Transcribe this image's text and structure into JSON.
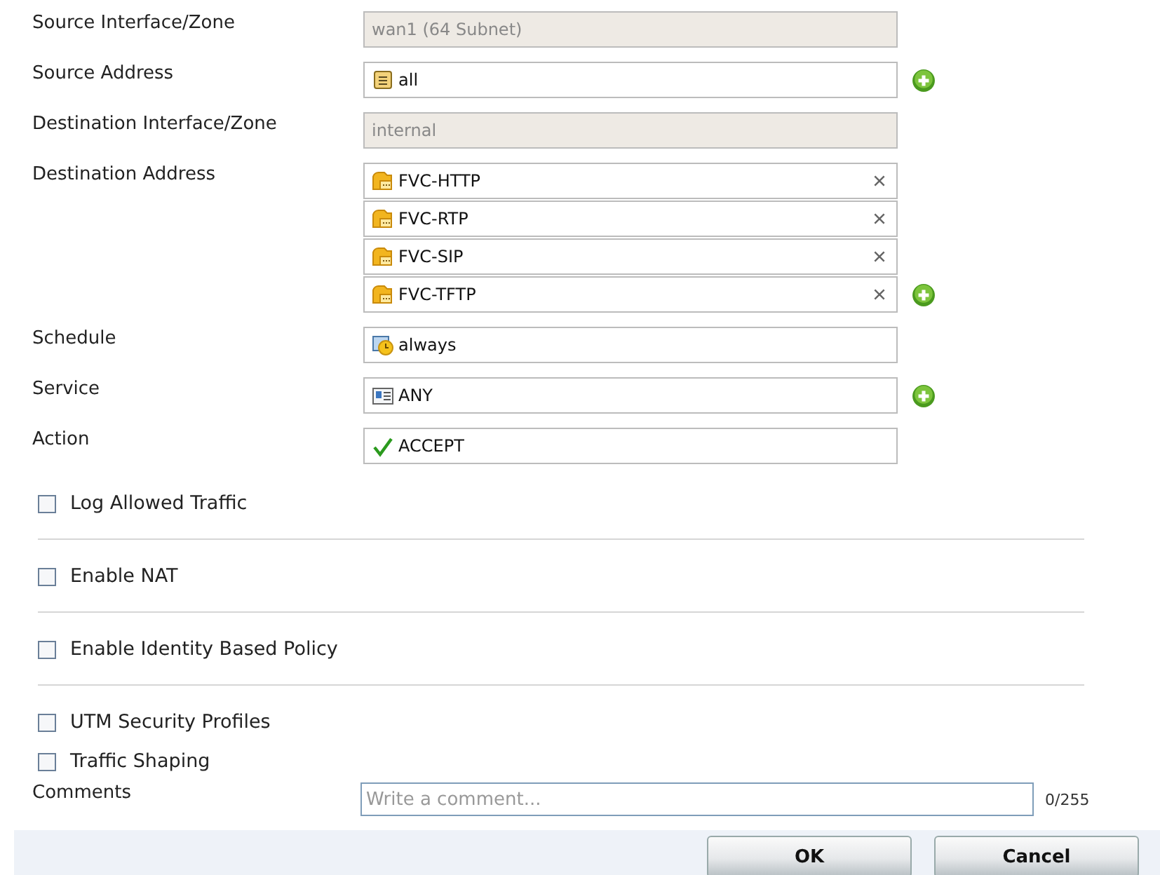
{
  "fields": [
    {
      "label": "Source Interface/Zone",
      "kind": "readonly",
      "value": "wan1 (64 Subnet)"
    },
    {
      "label": "Source Address",
      "kind": "select",
      "add": true,
      "items": [
        {
          "text": "all",
          "kind": "address",
          "removable": false
        }
      ]
    },
    {
      "label": "Destination Interface/Zone",
      "kind": "readonly",
      "value": "internal"
    },
    {
      "label": "Destination Address",
      "kind": "select",
      "add": true,
      "items": [
        {
          "text": "FVC-HTTP",
          "kind": "group",
          "removable": true
        },
        {
          "text": "FVC-RTP",
          "kind": "group",
          "removable": true
        },
        {
          "text": "FVC-SIP",
          "kind": "group",
          "removable": true
        },
        {
          "text": "FVC-TFTP",
          "kind": "group",
          "removable": true
        }
      ]
    },
    {
      "label": "Schedule",
      "kind": "select",
      "add": false,
      "items": [
        {
          "text": "always",
          "kind": "schedule",
          "removable": false
        }
      ]
    },
    {
      "label": "Service",
      "kind": "select",
      "add": true,
      "items": [
        {
          "text": "ANY",
          "kind": "service",
          "removable": false
        }
      ]
    },
    {
      "label": "Action",
      "kind": "select",
      "add": false,
      "items": [
        {
          "text": "ACCEPT",
          "kind": "accept",
          "removable": false
        }
      ]
    }
  ],
  "options": [
    {
      "label": "Log Allowed Traffic",
      "checked": false,
      "divider_after": true
    },
    {
      "label": "Enable NAT",
      "checked": false,
      "divider_after": true
    },
    {
      "label": "Enable Identity Based Policy",
      "checked": false,
      "divider_after": true
    },
    {
      "label": "UTM Security Profiles",
      "checked": false,
      "divider_after": false
    },
    {
      "label": "Traffic Shaping",
      "checked": false,
      "divider_after": false
    }
  ],
  "comments": {
    "label": "Comments",
    "placeholder": "Write a comment...",
    "counter": "0/255"
  },
  "buttons": [
    "OK",
    "Cancel"
  ]
}
